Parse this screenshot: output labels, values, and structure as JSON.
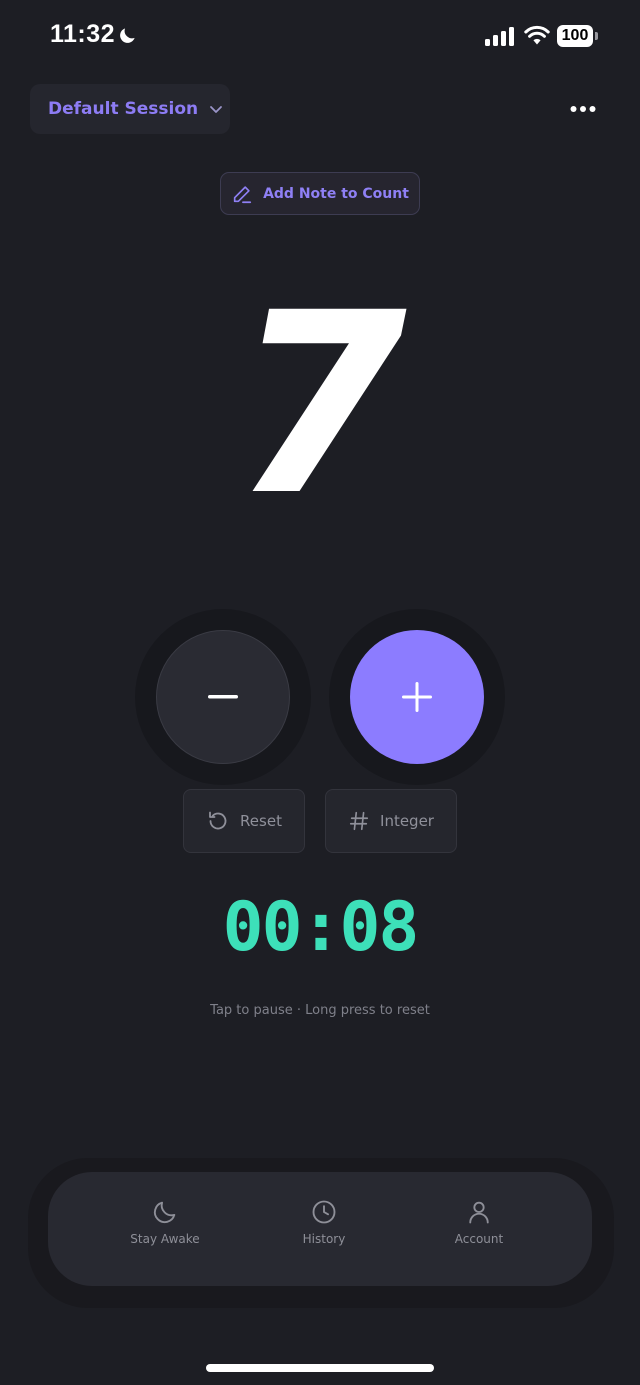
{
  "status_bar": {
    "time": "11:32",
    "battery": "100",
    "icons": [
      "moon-icon",
      "signal-icon",
      "wifi-icon",
      "battery-icon"
    ]
  },
  "header": {
    "session_label": "Default Session",
    "session_icon": "chevron-down-icon",
    "more_icon": "more-horizontal-icon"
  },
  "note": {
    "label": "Add Note to Count",
    "icon": "pencil-icon"
  },
  "counter": {
    "value": "7",
    "decrement_icon": "minus-icon",
    "increment_icon": "plus-icon"
  },
  "actions": {
    "reset_label": "Reset",
    "reset_icon": "rotate-ccw-icon",
    "integer_label": "Integer",
    "integer_icon": "hash-icon"
  },
  "timer": {
    "value": "00:08",
    "hint": "Tap to pause · Long press to reset"
  },
  "tabbar": {
    "items": [
      {
        "label": "Stay Awake",
        "icon": "moon-icon"
      },
      {
        "label": "History",
        "icon": "clock-icon"
      },
      {
        "label": "Account",
        "icon": "user-icon"
      }
    ]
  },
  "colors": {
    "background": "#1d1e24",
    "accent": "#8c7cff",
    "timer": "#3de0b9"
  }
}
